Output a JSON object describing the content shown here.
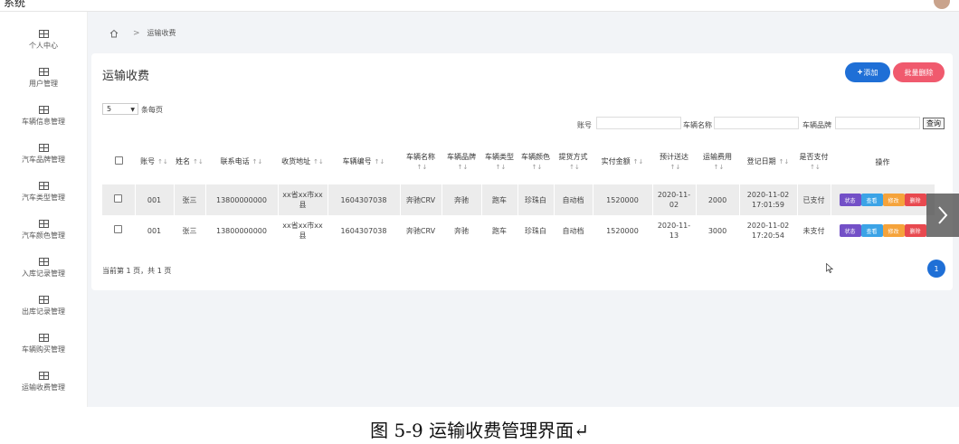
{
  "app": {
    "title": "系统"
  },
  "sidebar": {
    "items": [
      {
        "label": "个人中心"
      },
      {
        "label": "用户管理"
      },
      {
        "label": "车辆信息管理"
      },
      {
        "label": "汽车品牌管理"
      },
      {
        "label": "汽车类型管理"
      },
      {
        "label": "汽车颜色管理"
      },
      {
        "label": "入库记录管理"
      },
      {
        "label": "出库记录管理"
      },
      {
        "label": "车辆购买管理"
      },
      {
        "label": "运输收费管理"
      }
    ]
  },
  "breadcrumb": {
    "current": "运输收费"
  },
  "card": {
    "title": "运输收费",
    "add_label": "添加",
    "batch_delete_label": "批量删除",
    "page_size": "5",
    "per_page_label": "条每页"
  },
  "filters": {
    "account_label": "账号",
    "vehicle_name_label": "车辆名称",
    "vehicle_brand_label": "车辆品牌",
    "search_label": "查询"
  },
  "table": {
    "headers": [
      "账号",
      "姓名",
      "联系电话",
      "收货地址",
      "车辆编号",
      "车辆名称",
      "车辆品牌",
      "车辆类型",
      "车辆颜色",
      "提货方式",
      "实付金额",
      "预计送达",
      "运输费用",
      "登记日期",
      "是否支付",
      "操作"
    ],
    "rows": [
      [
        "001",
        "张三",
        "13800000000",
        "xx省xx市xx县",
        "1604307038",
        "奔驰CRV",
        "奔驰",
        "跑车",
        "珍珠白",
        "自动档",
        "1520000",
        "2020-11-02",
        "2000",
        "2020-11-02 17:01:59",
        "已支付"
      ],
      [
        "001",
        "张三",
        "13800000000",
        "xx省xx市xx县",
        "1604307038",
        "奔驰CRV",
        "奔驰",
        "跑车",
        "珍珠白",
        "自动档",
        "1520000",
        "2020-11-13",
        "3000",
        "2020-11-02 17:20:54",
        "未支付"
      ]
    ],
    "actions": {
      "status": "状态",
      "view": "查看",
      "edit": "修改",
      "delete": "删除"
    }
  },
  "pagination": {
    "info": "当前第 1 页，共 1 页",
    "current": "1"
  },
  "caption": "图 5-9 运输收费管理界面↵",
  "colors": {
    "primary": "#1f6fd6",
    "danger": "#f05a6e",
    "status": "#7350c7",
    "view": "#3ba3e6",
    "edit": "#f5a33b",
    "delete": "#e8494f"
  }
}
